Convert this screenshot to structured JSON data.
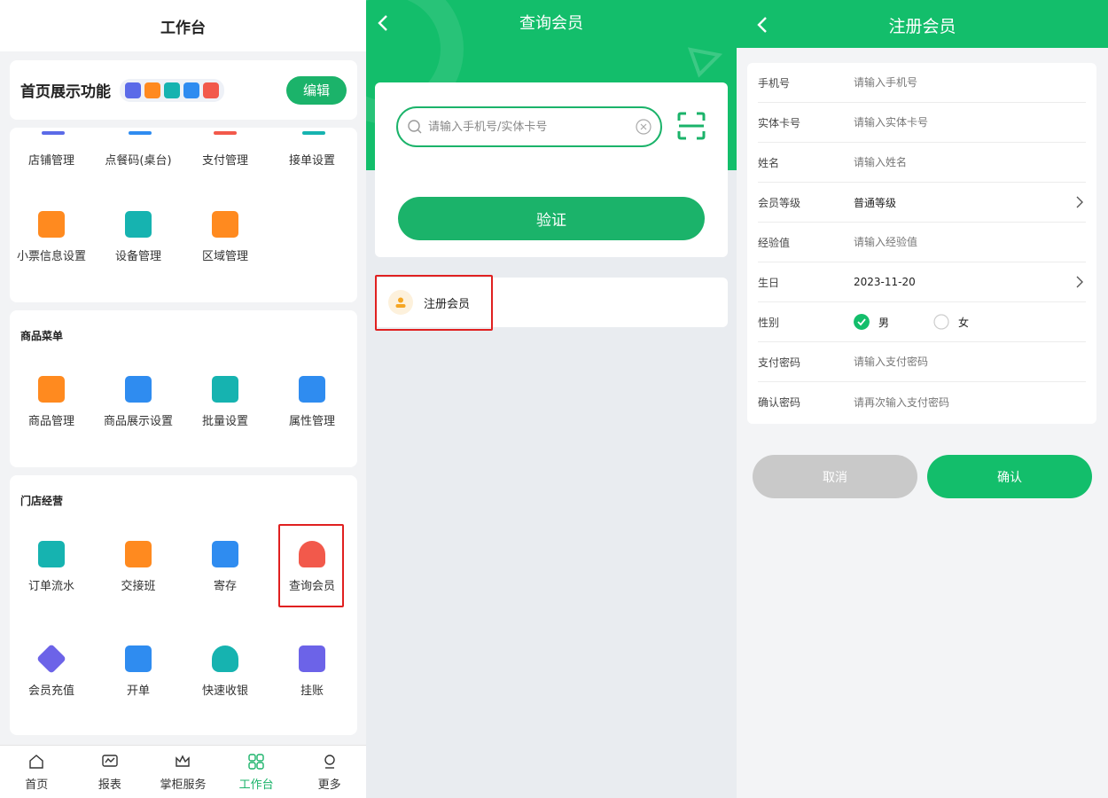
{
  "workbench": {
    "title": "工作台",
    "showcase": {
      "title": "首页展示功能",
      "edit_label": "编辑"
    },
    "store_settings": {
      "row1": [
        "店铺管理",
        "点餐码(桌台)",
        "支付管理",
        "接单设置"
      ],
      "row2": [
        "小票信息设置",
        "设备管理",
        "区域管理"
      ]
    },
    "goods_menu": {
      "title": "商品菜单",
      "items": [
        "商品管理",
        "商品展示设置",
        "批量设置",
        "属性管理"
      ]
    },
    "store_ops": {
      "title": "门店经营",
      "row1": [
        "订单流水",
        "交接班",
        "寄存",
        "查询会员"
      ],
      "row2": [
        "会员充值",
        "开单",
        "快速收银",
        "挂账"
      ]
    },
    "tabs": [
      "首页",
      "报表",
      "掌柜服务",
      "工作台",
      "更多"
    ]
  },
  "query_member": {
    "title": "查询会员",
    "search_placeholder": "请输入手机号/实体卡号",
    "verify_label": "验证",
    "register_label": "注册会员"
  },
  "register": {
    "title": "注册会员",
    "fields": {
      "phone": {
        "label": "手机号",
        "placeholder": "请输入手机号"
      },
      "card": {
        "label": "实体卡号",
        "placeholder": "请输入实体卡号"
      },
      "name": {
        "label": "姓名",
        "placeholder": "请输入姓名"
      },
      "level": {
        "label": "会员等级",
        "value": "普通等级"
      },
      "exp": {
        "label": "经验值",
        "placeholder": "请输入经验值"
      },
      "birthday": {
        "label": "生日",
        "value": "2023-11-20"
      },
      "gender": {
        "label": "性别",
        "male": "男",
        "female": "女",
        "selected": "男"
      },
      "pay_pwd": {
        "label": "支付密码",
        "placeholder": "请输入支付密码"
      },
      "confirm_pwd": {
        "label": "确认密码",
        "placeholder": "请再次输入支付密码"
      }
    },
    "cancel_label": "取消",
    "confirm_label": "确认"
  },
  "colors": {
    "primary": "#1bb36a",
    "header_green": "#13be6b",
    "highlight": "#e02020"
  }
}
